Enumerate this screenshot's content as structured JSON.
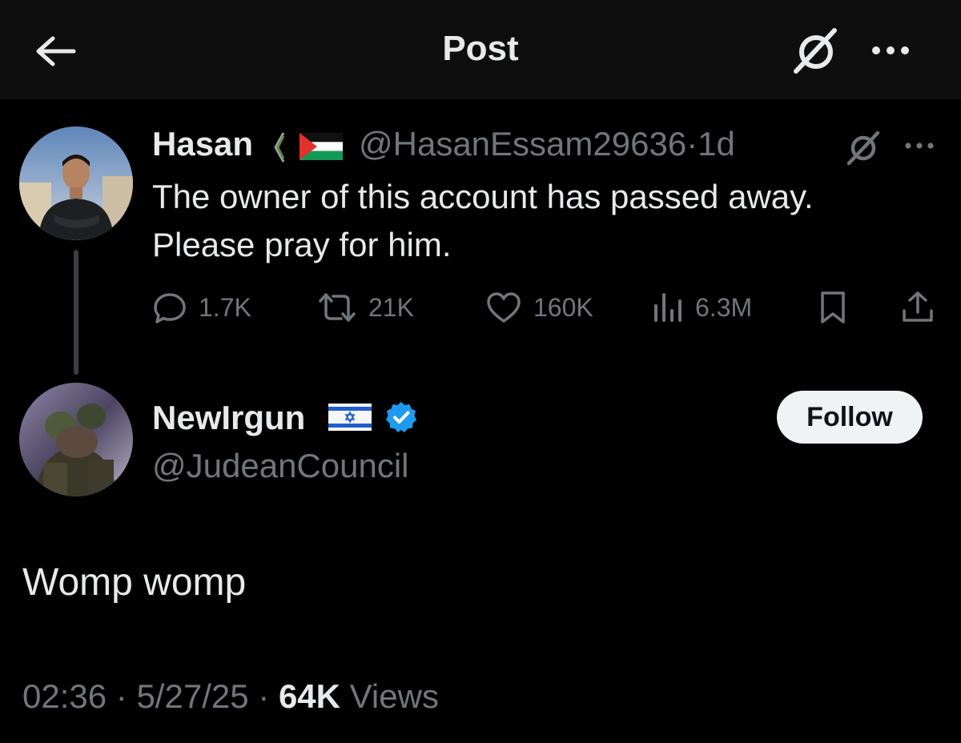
{
  "header": {
    "title": "Post",
    "back_icon": "arrow-left-icon",
    "grok_icon": "grok-icon",
    "more_icon": "more-horizontal-icon"
  },
  "parent_post": {
    "name": "Hasan",
    "name_emojis": [
      "watermelon-slice",
      "palestine-flag"
    ],
    "handle": "@HasanEssam29636",
    "separator": "·",
    "time": "1d",
    "text_line1": "The owner of this account has passed away.",
    "text_line2": "Please pray for him.",
    "actions": {
      "replies": "1.7K",
      "reposts": "21K",
      "likes": "160K",
      "views": "6.3M"
    }
  },
  "main_post": {
    "name": "NewIrgun",
    "name_emoji": "israel-flag",
    "verified_color": "#1d9bf0",
    "handle": "@JudeanCouncil",
    "follow_label": "Follow",
    "text": "Womp womp",
    "time": "02:36",
    "sep1": "·",
    "date": "5/27/25",
    "sep2": "·",
    "views_count": "64K",
    "views_label": "Views"
  },
  "colors": {
    "background": "#000000",
    "header_bg": "#0e0e0e",
    "text_primary": "#e7e9ea",
    "text_secondary": "#71767b",
    "verified_blue": "#1d9bf0"
  }
}
